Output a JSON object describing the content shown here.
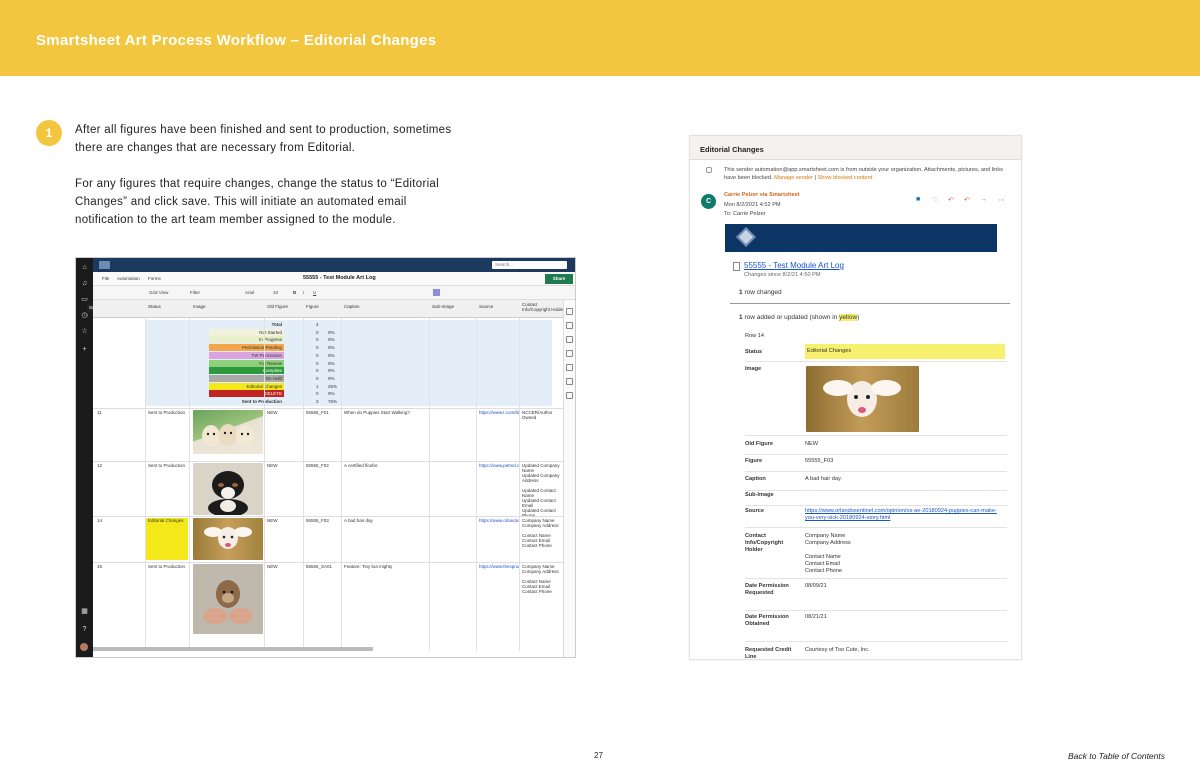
{
  "banner": {
    "title": "Smartsheet Art Process Workflow – Editorial Changes",
    "color": "#f3c63f"
  },
  "step": {
    "number": "1",
    "para1": "After all figures have been finished and sent to production, sometimes there are changes that are necessary from Editorial.",
    "para2": "For any figures that require changes, change the status to “Editorial Changes” and click save. This will initiate an automated email notification to the art team member assigned to the module."
  },
  "sheet": {
    "search_placeholder": "Search...",
    "menu": [
      "File",
      "Automation",
      "Forms"
    ],
    "title": "55555 - Test Module Art Log",
    "share": "Share",
    "tooltip": "Save (⌘ + S)",
    "toolbar": [
      "Grid View",
      "Filter",
      "Arial",
      "10"
    ],
    "columns": [
      "Status",
      "Image",
      "Old Figure",
      "Figure",
      "Caption",
      "Sub-Image",
      "Source",
      "Contact Info/Copyright Holder"
    ],
    "summary_rows": [
      {
        "label": "Total",
        "value": "4",
        "pct": "",
        "color": ""
      },
      {
        "label": "Not Started",
        "value": "0",
        "pct": "0%",
        "color": "#f4f1dc"
      },
      {
        "label": "In Progress",
        "value": "0",
        "pct": "0%",
        "color": "#e6f0c9"
      },
      {
        "label": "Permission Pending",
        "value": "0",
        "pct": "0%",
        "color": "#f3a64a"
      },
      {
        "label": "TW Permission",
        "value": "0",
        "pct": "0%",
        "color": "#d9a3e0"
      },
      {
        "label": "For Review",
        "value": "0",
        "pct": "0%",
        "color": "#8fd07a"
      },
      {
        "label": "Complete",
        "value": "0",
        "pct": "0%",
        "color": "#2e9a3c"
      },
      {
        "label": "On Hold",
        "value": "0",
        "pct": "0%",
        "color": "#a9a9a9"
      },
      {
        "label": "Editorial Changes",
        "value": "1",
        "pct": "25%",
        "color": "#f4e81b"
      },
      {
        "label": "DELETE",
        "value": "0",
        "pct": "0%",
        "color": "#c22424"
      },
      {
        "label": "Sent to Production",
        "value": "3",
        "pct": "75%",
        "color": ""
      }
    ],
    "rows": [
      {
        "num": "11",
        "status": "Sent to Production",
        "old": "NEW",
        "figure": "55555_F01",
        "caption": "When do Puppies Start Walking?",
        "source": "https://www.t.com/blogs",
        "contact": "NCCER/Author Owned"
      },
      {
        "num": "12",
        "status": "Sent to Production",
        "old": "NEW",
        "figure": "55555_F02",
        "caption": "A certified floofer",
        "source": "https://www.petmd.com",
        "contact": "Updated Company Name\nUpdated Company Address\n\nUpdated Contact Name\nUpdated Contact Email\nUpdated Contact Phone"
      },
      {
        "num": "14",
        "status": "Editorial Changes",
        "old": "NEW",
        "figure": "55555_F03",
        "caption": "A bad hair day",
        "source": "https://www.orlandosen",
        "contact": "Company Name\nCompany Address\n\nContact Name\nContact Email\nContact Phone"
      },
      {
        "num": "15",
        "status": "Sent to Production",
        "old": "NEW",
        "figure": "55555_SA01",
        "caption": "Feature: Tiny but mighty",
        "source": "https://www.thesprucep",
        "contact": "Company Name\nCompany Address\n\nContact Name\nContact Email\nContact Phone"
      }
    ]
  },
  "email": {
    "header": "Editorial Changes",
    "warning": "This sender automation@app.smartsheet.com is from outside your organization. Attachments, pictures, and links have been blocked.",
    "manage_sender": "Manage sender",
    "separator": "|",
    "show_blocked": "Show blocked content",
    "avatar_letter": "C",
    "from": "Carrie Pelzer via Smartsheet",
    "date": "Mon 8/2/2021 4:52 PM",
    "to": "To:  Carrie Pelzer",
    "sheet_link": "55555 - Test Module Art Log",
    "changes_since": "Changes since 8/2/21 4:50 PM",
    "rows_changed_count": "1",
    "rows_changed_text": "row changed",
    "rows_updated_count": "1",
    "rows_updated_text": "row added or updated (shown in",
    "rows_updated_hl": "yellow",
    "rows_updated_end": ")",
    "row_label": "Row 14",
    "fields": [
      {
        "k": "Status",
        "v": "Editorial Changes"
      },
      {
        "k": "Image",
        "v": ""
      },
      {
        "k": "Old Figure",
        "v": "NEW"
      },
      {
        "k": "Figure",
        "v": "55555_F03"
      },
      {
        "k": "Caption",
        "v": "A bad hair day."
      },
      {
        "k": "Sub-Image",
        "v": ""
      },
      {
        "k": "Source",
        "v": "https://www.orlandosentinel.com/opinion/os-ae-20180924-puppies-can-make-you-very-sick-20180924-story.html"
      },
      {
        "k": "Contact Info/Copyright Holder",
        "v": "Company Name\nCompany Address\n\nContact Name\nContact Email\nContact Phone"
      },
      {
        "k": "Date Permission Requested",
        "v": "08/09/21"
      },
      {
        "k": "Date Permission Obtained",
        "v": "08/21/21"
      },
      {
        "k": "Requested Credit Line",
        "v": "Courtesy of Too Cute, Inc."
      }
    ]
  },
  "footer": {
    "page": "27",
    "toc": "Back to Table of Contents"
  }
}
